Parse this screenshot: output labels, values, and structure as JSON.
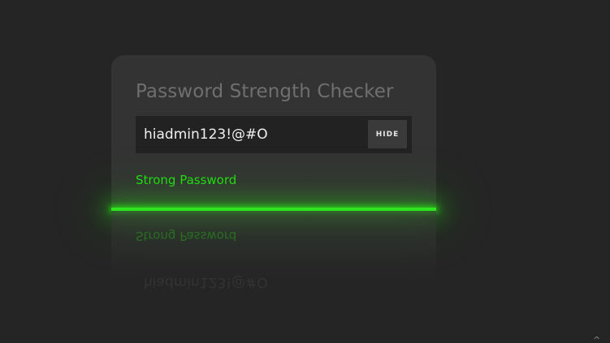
{
  "checker": {
    "title": "Password Strength Checker",
    "password_value": "hiadmin123!@#O",
    "hide_label": "HIDE",
    "status_text": "Strong Password",
    "strength_level": 1.0,
    "colors": {
      "background": "#252525",
      "card": "#333333",
      "input_bg": "#222222",
      "strong": "#2ee51f"
    }
  },
  "corner_glyph": "^"
}
